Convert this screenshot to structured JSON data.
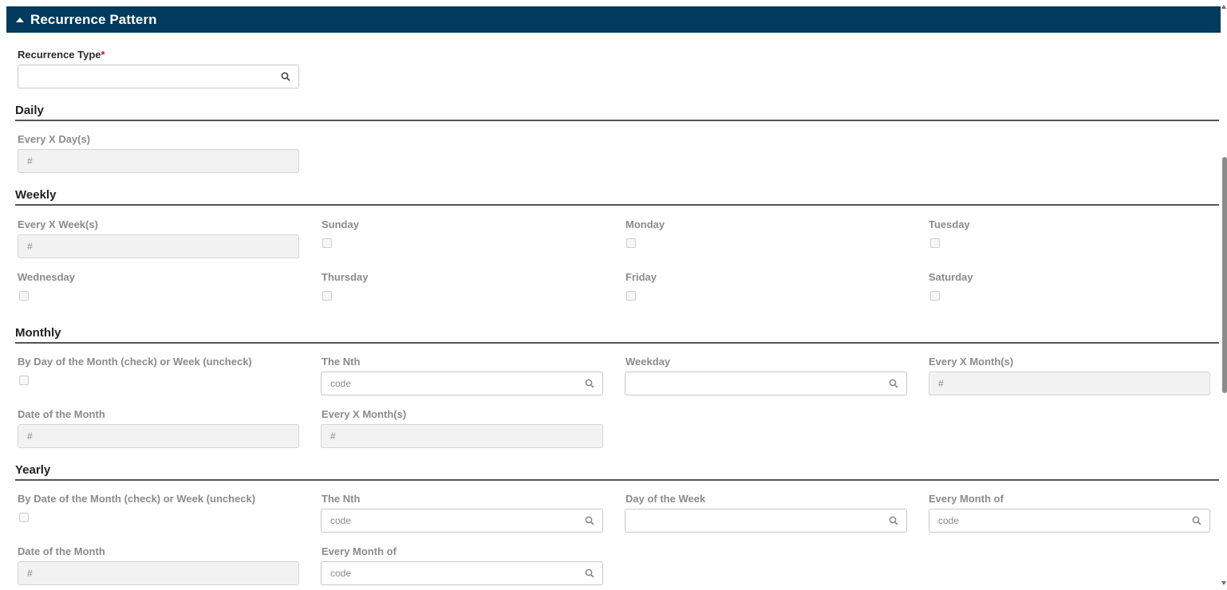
{
  "panel": {
    "title": "Recurrence Pattern"
  },
  "recurrence_type": {
    "label": "Recurrence Type",
    "required_mark": "*",
    "value": ""
  },
  "daily": {
    "title": "Daily",
    "every_x_days": {
      "label": "Every X Day(s)",
      "placeholder": "#"
    }
  },
  "weekly": {
    "title": "Weekly",
    "every_x_weeks": {
      "label": "Every X Week(s)",
      "placeholder": "#"
    },
    "days": [
      "Sunday",
      "Monday",
      "Tuesday",
      "Wednesday",
      "Thursday",
      "Friday",
      "Saturday"
    ]
  },
  "monthly": {
    "title": "Monthly",
    "by_day_toggle": {
      "label": "By Day of the Month (check) or Week (uncheck)"
    },
    "the_nth": {
      "label": "The Nth",
      "placeholder": "code"
    },
    "weekday": {
      "label": "Weekday",
      "value": ""
    },
    "every_x_months_a": {
      "label": "Every X Month(s)",
      "placeholder": "#"
    },
    "date_of_month": {
      "label": "Date of the Month",
      "placeholder": "#"
    },
    "every_x_months_b": {
      "label": "Every X Month(s)",
      "placeholder": "#"
    }
  },
  "yearly": {
    "title": "Yearly",
    "by_date_toggle": {
      "label": "By Date of the Month (check) or Week (uncheck)"
    },
    "the_nth": {
      "label": "The Nth",
      "placeholder": "code"
    },
    "day_of_week": {
      "label": "Day of the Week",
      "value": ""
    },
    "every_month_of_a": {
      "label": "Every Month of",
      "placeholder": "code"
    },
    "date_of_month": {
      "label": "Date of the Month",
      "placeholder": "#"
    },
    "every_month_of_b": {
      "label": "Every Month of",
      "placeholder": "code"
    }
  },
  "icons": {
    "search": "search-icon",
    "collapse": "caret-up-icon"
  },
  "colors": {
    "header_bg": "#003a5d",
    "required": "#c8102e"
  }
}
